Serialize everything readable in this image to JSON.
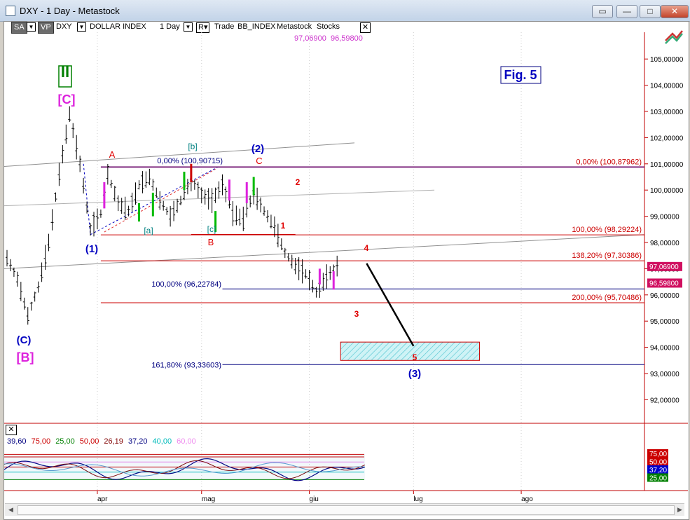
{
  "window": {
    "title": "DXY - 1 Day - Metastock",
    "buttons": [
      "▭",
      "—",
      "□",
      "✕"
    ]
  },
  "toolbar": {
    "sa": "SA",
    "vp": "VP",
    "symbol": "DXY",
    "name": "DOLLAR INDEX",
    "period": "1 Day",
    "r_btn": "R",
    "trade": "Trade",
    "bb": "BB_INDEX",
    "ms": "Metastock",
    "stocks": "Stocks",
    "close": "✕"
  },
  "hilo": {
    "high": "97,06900",
    "low": "96,59800"
  },
  "colors": {
    "price_line": "#000000",
    "fib_red": "#cc0000",
    "fib_blue": "#000080",
    "fib_purple": "#660066",
    "wave_red": "#e00000",
    "wave_blue": "#0000c0",
    "wave_magenta": "#dd22dd",
    "wave_green": "#008000",
    "target_box": "#6fd6e0"
  },
  "chart_data": {
    "type": "line",
    "title": "",
    "y_axis": {
      "range": [
        91.0,
        106.0
      ],
      "ticks": [
        "105,00000",
        "104,00000",
        "103,00000",
        "102,00000",
        "101,00000",
        "100,00000",
        "99,00000",
        "98,00000",
        "97,00000",
        "96,00000",
        "95,00000",
        "94,00000",
        "93,00000",
        "92,00000"
      ],
      "tick_values": [
        105,
        104,
        103,
        102,
        101,
        100,
        99,
        98,
        97,
        96,
        95,
        94,
        93,
        92
      ]
    },
    "x_axis": {
      "labels": [
        "apr",
        "mag",
        "giu",
        "lug",
        "ago"
      ],
      "label_days": [
        26,
        56,
        87,
        117,
        148
      ]
    },
    "price_markers": [
      {
        "text": "97,06900",
        "value": 97.069
      },
      {
        "text": "96,59800",
        "value": 96.598
      }
    ],
    "series": [
      {
        "values_x": [
          0,
          3,
          6,
          9,
          12,
          15,
          18,
          21,
          24,
          27,
          29,
          32,
          35,
          38,
          41,
          44,
          47,
          50,
          53,
          56,
          59,
          62,
          65,
          68,
          71,
          74,
          77,
          80,
          83,
          86,
          89,
          92,
          95
        ],
        "values_y": [
          97.4,
          96.6,
          95.2,
          96.3,
          98.0,
          100.6,
          102.9,
          101.0,
          98.5,
          99.1,
          100.6,
          99.5,
          99.2,
          100.2,
          100.5,
          99.6,
          99.0,
          99.6,
          100.4,
          99.8,
          99.6,
          100.2,
          99.1,
          98.9,
          99.9,
          99.2,
          98.6,
          97.6,
          97.1,
          96.8,
          96.1,
          96.7,
          97.1
        ]
      }
    ],
    "fib_levels": [
      {
        "text": "0,00% (100,87962)",
        "value": 100.88,
        "color": "#cc0000",
        "side": "right"
      },
      {
        "text": "100,00% (98,29224)",
        "value": 98.29,
        "color": "#cc0000",
        "side": "right"
      },
      {
        "text": "138,20% (97,30386)",
        "value": 97.3,
        "color": "#cc0000",
        "side": "right"
      },
      {
        "text": "200,00% (95,70486)",
        "value": 95.7,
        "color": "#cc0000",
        "side": "right"
      },
      {
        "text": "0,00% (100,90715)",
        "value": 100.91,
        "color": "#000080",
        "side": "left"
      },
      {
        "text": "100,00% (96,22784)",
        "value": 96.23,
        "color": "#000080",
        "side": "left"
      },
      {
        "text": "161,80% (93,33603)",
        "value": 93.34,
        "color": "#000080",
        "side": "left"
      }
    ],
    "wave_labels": [
      {
        "text": "II",
        "color": "#008000"
      },
      {
        "text": "[C]",
        "color": "#dd22dd"
      },
      {
        "text": "(C)",
        "color": "#0000c0"
      },
      {
        "text": "[B]",
        "color": "#dd22dd"
      },
      {
        "text": "A",
        "color": "#e00000"
      },
      {
        "text": "(1)",
        "color": "#0000c0"
      },
      {
        "text": "[b]",
        "color": "#008080"
      },
      {
        "text": "(2)",
        "color": "#0000c0"
      },
      {
        "text": "C",
        "color": "#e00000"
      },
      {
        "text": "[a]",
        "color": "#008080"
      },
      {
        "text": "[c]",
        "color": "#008080"
      },
      {
        "text": "B",
        "color": "#e00000"
      },
      {
        "text": "1",
        "color": "#e00000"
      },
      {
        "text": "2",
        "color": "#e00000"
      },
      {
        "text": "3",
        "color": "#e00000"
      },
      {
        "text": "4",
        "color": "#e00000"
      },
      {
        "text": "5",
        "color": "#e00000"
      },
      {
        "text": "(3)",
        "color": "#0000c0"
      }
    ],
    "fig_label": "Fig. 5"
  },
  "indicator": {
    "values": [
      {
        "text": "39,60",
        "color": "#000080"
      },
      {
        "text": "75,00",
        "color": "#cc0000"
      },
      {
        "text": "25,00",
        "color": "#008000"
      },
      {
        "text": "50,00",
        "color": "#cc0000"
      },
      {
        "text": "26,19",
        "color": "#800000"
      },
      {
        "text": "37,20",
        "color": "#000080"
      },
      {
        "text": "40,00",
        "color": "#00bbbb"
      },
      {
        "text": "60,00",
        "color": "#ee88ee"
      }
    ],
    "right_tags": [
      {
        "text": "75,00",
        "color": "#cc0000"
      },
      {
        "text": "50,00",
        "color": "#cc0000"
      },
      {
        "text": "37,20",
        "color": "#0000cc"
      },
      {
        "text": "25,00",
        "color": "#008000"
      }
    ],
    "close": "✕"
  }
}
